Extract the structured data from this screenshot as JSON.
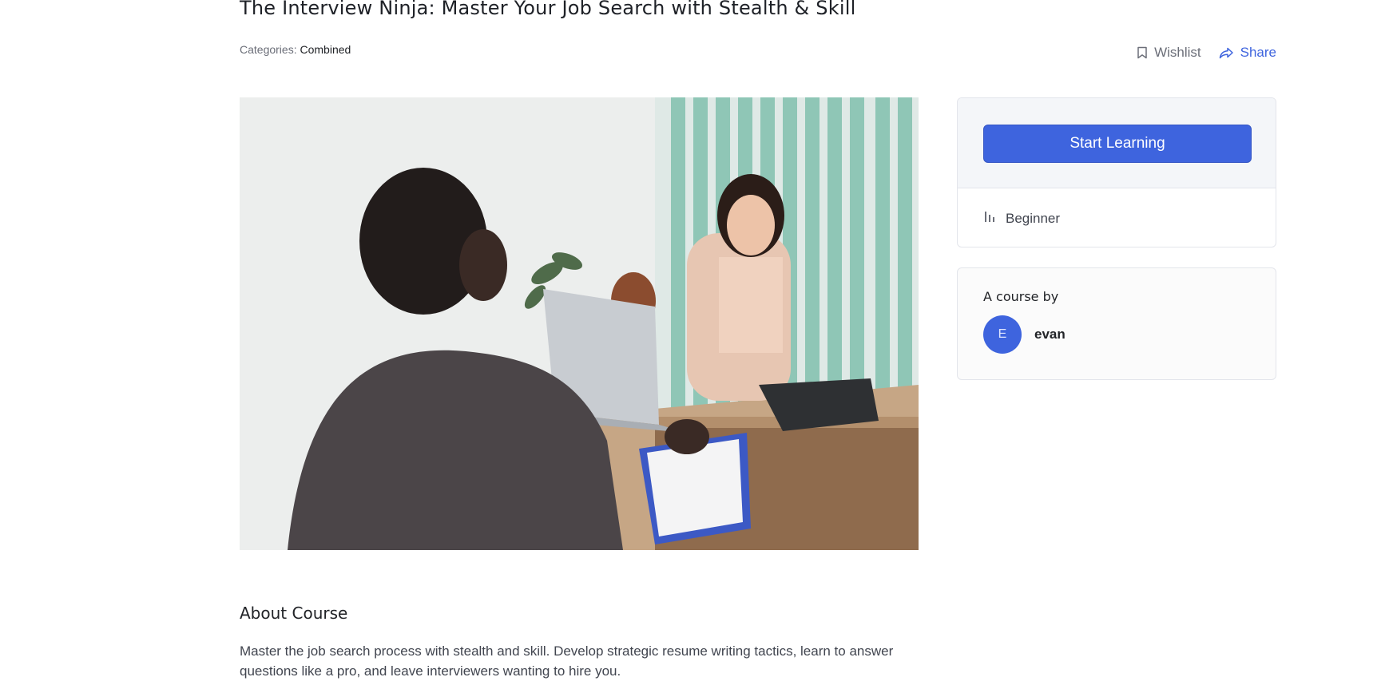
{
  "course": {
    "title": "The Interview Ninja: Master Your Job Search with Stealth & Skill",
    "categories_label": "Categories:",
    "category": "Combined"
  },
  "actions": {
    "wishlist": "Wishlist",
    "share": "Share",
    "wishlist_icon": "bookmark-icon",
    "share_icon": "share-arrow-icon"
  },
  "sidebar": {
    "start_button": "Start Learning",
    "level_icon": "level-bars-icon",
    "level": "Beginner",
    "author_heading": "A course by",
    "author_initial": "E",
    "author_name": "evan"
  },
  "about": {
    "heading": "About Course",
    "text": "Master the job search process with stealth and skill. Develop strategic resume writing tactics, learn to answer questions like a pro, and leave interviewers wanting to hire you."
  },
  "colors": {
    "accent": "#3e64de",
    "text": "#212327",
    "muted": "#6b6e78"
  }
}
